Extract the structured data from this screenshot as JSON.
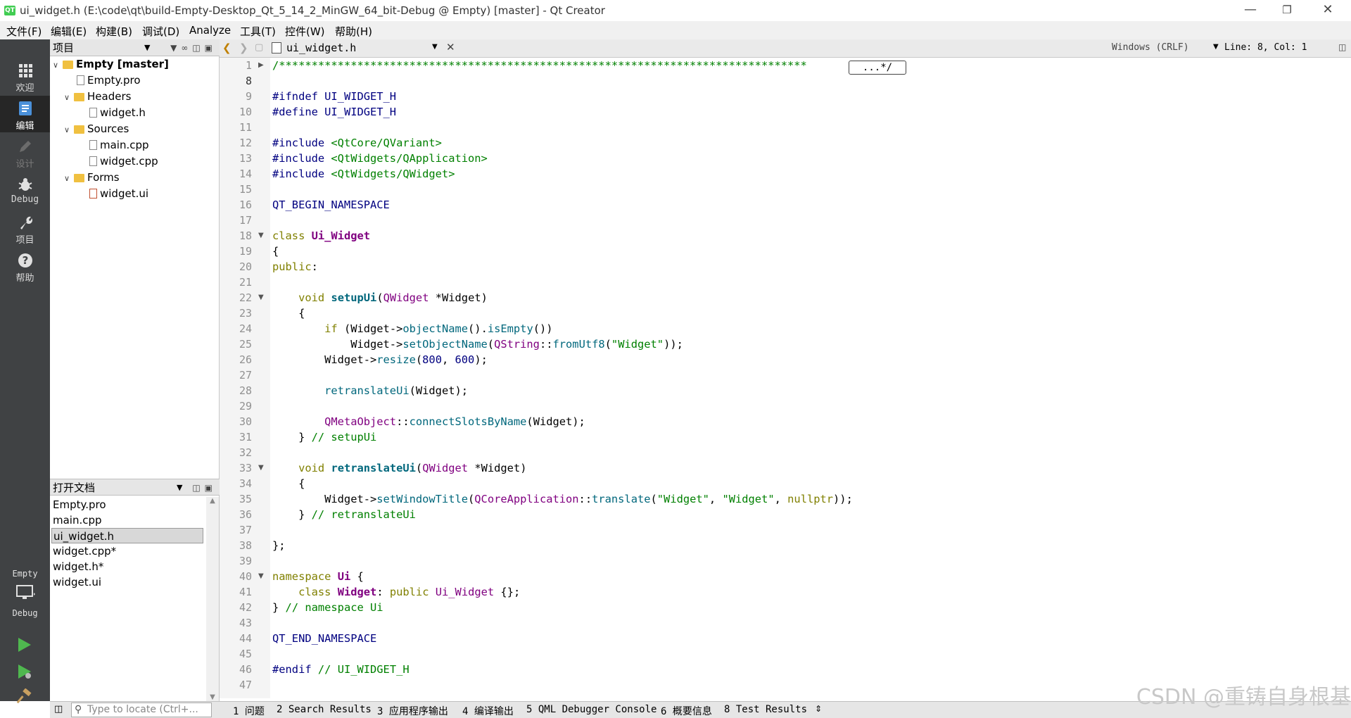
{
  "window": {
    "title": "ui_widget.h (E:\\code\\qt\\build-Empty-Desktop_Qt_5_14_2_MinGW_64_bit-Debug @ Empty) [master] - Qt Creator",
    "logo_text": "QT"
  },
  "menu": [
    "文件(F)",
    "编辑(E)",
    "构建(B)",
    "调试(D)",
    "Analyze",
    "工具(T)",
    "控件(W)",
    "帮助(H)"
  ],
  "nav": {
    "items": [
      {
        "label": "欢迎",
        "icon": "grid-icon"
      },
      {
        "label": "编辑",
        "icon": "edit-icon"
      },
      {
        "label": "设计",
        "icon": "pencil-icon"
      },
      {
        "label": "Debug",
        "icon": "bug-icon"
      },
      {
        "label": "项目",
        "icon": "wrench-icon"
      },
      {
        "label": "帮助",
        "icon": "help-icon"
      }
    ],
    "kit_project": "Empty",
    "kit_mode": "Debug"
  },
  "project_pane": {
    "title": "项目",
    "tree": [
      {
        "label": "Empty [master]",
        "level": 0,
        "expanded": true,
        "icon": "project-folder-icon",
        "bold": true
      },
      {
        "label": "Empty.pro",
        "level": 1,
        "icon": "pro-file-icon"
      },
      {
        "label": "Headers",
        "level": 1,
        "expanded": true,
        "icon": "folder-icon"
      },
      {
        "label": "widget.h",
        "level": 2,
        "icon": "header-file-icon"
      },
      {
        "label": "Sources",
        "level": 1,
        "expanded": true,
        "icon": "folder-icon"
      },
      {
        "label": "main.cpp",
        "level": 2,
        "icon": "cpp-file-icon"
      },
      {
        "label": "widget.cpp",
        "level": 2,
        "icon": "cpp-file-icon"
      },
      {
        "label": "Forms",
        "level": 1,
        "expanded": true,
        "icon": "folder-icon"
      },
      {
        "label": "widget.ui",
        "level": 2,
        "icon": "ui-file-icon"
      }
    ]
  },
  "open_docs": {
    "title": "打开文档",
    "items": [
      "Empty.pro",
      "main.cpp",
      "ui_widget.h",
      "widget.cpp*",
      "widget.h*",
      "widget.ui"
    ],
    "selected": "ui_widget.h"
  },
  "editor": {
    "file": "ui_widget.h",
    "line_ending": "Windows (CRLF)",
    "position": "Line: 8, Col: 1",
    "fold_placeholder": "...*/",
    "current_line": "8",
    "line_numbers": [
      "1",
      "8",
      "9",
      "10",
      "11",
      "12",
      "13",
      "14",
      "15",
      "16",
      "17",
      "18",
      "19",
      "20",
      "21",
      "22",
      "23",
      "24",
      "25",
      "26",
      "27",
      "28",
      "29",
      "30",
      "31",
      "32",
      "33",
      "34",
      "35",
      "36",
      "37",
      "38",
      "39",
      "40",
      "41",
      "42",
      "43",
      "44",
      "45",
      "46",
      "47"
    ]
  },
  "status": {
    "locate_placeholder": "Type to locate (Ctrl+...",
    "tabs": [
      "1 问题",
      "2 Search Results",
      "3 应用程序输出",
      "4 编译输出",
      "5 QML Debugger Console",
      "6 概要信息",
      "8 Test Results"
    ]
  },
  "watermark": "CSDN @重铸自身根基"
}
